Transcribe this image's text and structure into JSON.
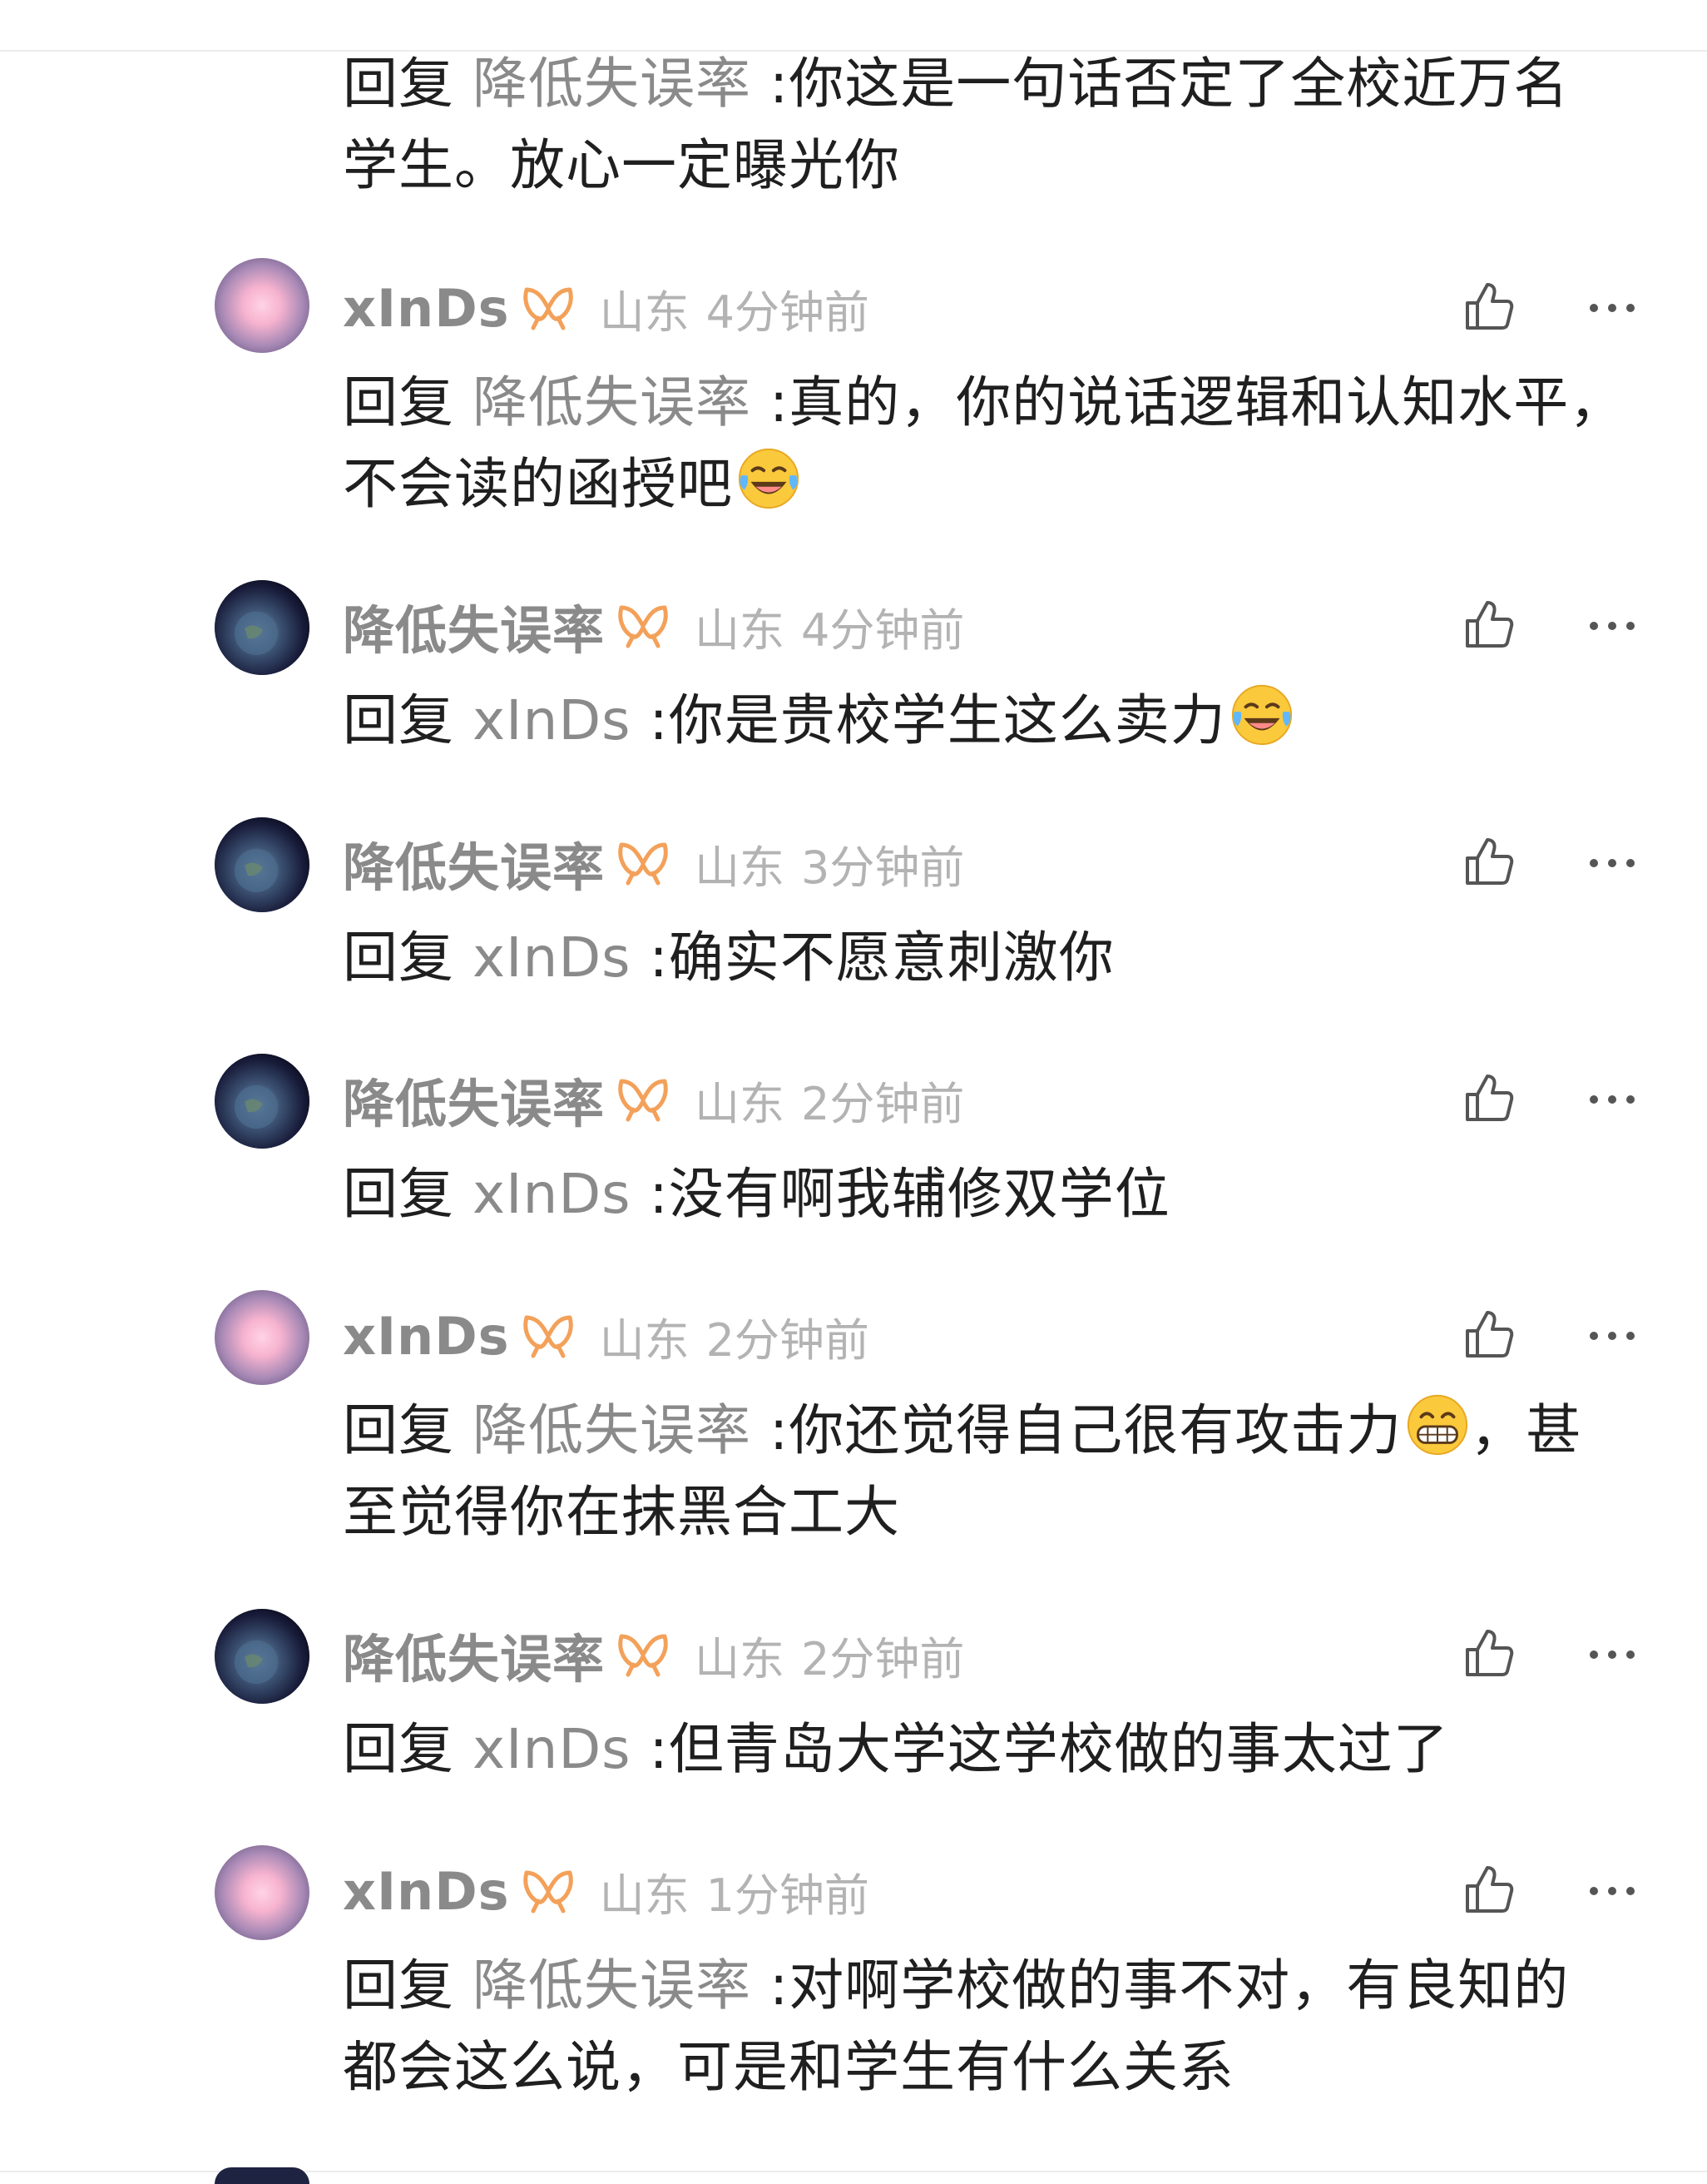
{
  "top_partial": {
    "reply_prefix": "回复",
    "target": "降低失误率",
    "text_line1": " :你这是一句话否定了全校近万名",
    "text_line2": "学生。放心一定曝光你"
  },
  "comments": [
    {
      "avatar": "pink-avatar",
      "name": "xInDs",
      "location": "山东",
      "time": "4分钟前",
      "reply_prefix": "回复",
      "target": "降低失误率",
      "line1": " :真的，你的说话逻辑和认知水平，",
      "line2": "不会读的函授吧",
      "emoji": "laughing-crying"
    },
    {
      "avatar": "planet-avatar",
      "name": "降低失误率",
      "location": "山东",
      "time": "4分钟前",
      "reply_prefix": "回复",
      "target": "xInDs",
      "line1": " :你是贵校学生这么卖力",
      "emoji": "laughing-crying"
    },
    {
      "avatar": "planet-avatar",
      "name": "降低失误率",
      "location": "山东",
      "time": "3分钟前",
      "reply_prefix": "回复",
      "target": "xInDs",
      "line1": " :确实不愿意刺激你"
    },
    {
      "avatar": "planet-avatar",
      "name": "降低失误率",
      "location": "山东",
      "time": "2分钟前",
      "reply_prefix": "回复",
      "target": "xInDs",
      "line1": " :没有啊我辅修双学位"
    },
    {
      "avatar": "pink-avatar",
      "name": "xInDs",
      "location": "山东",
      "time": "2分钟前",
      "reply_prefix": "回复",
      "target": "降低失误率",
      "line1_a": " :你还觉得自己很有攻击力",
      "line1_b": "，甚",
      "line2": "至觉得你在抹黑合工大",
      "emoji": "grinning"
    },
    {
      "avatar": "planet-avatar",
      "name": "降低失误率",
      "location": "山东",
      "time": "2分钟前",
      "reply_prefix": "回复",
      "target": "xInDs",
      "line1": " :但青岛大学这学校做的事太过了"
    },
    {
      "avatar": "pink-avatar",
      "name": "xInDs",
      "location": "山东",
      "time": "1分钟前",
      "reply_prefix": "回复",
      "target": "降低失误率",
      "line1": " :对啊学校做的事不对，有良知的",
      "line2": "都会这么说，可是和学生有什么关系"
    }
  ],
  "icons": {
    "badge": "vip-ribbon-icon",
    "like": "thumbs-up-icon",
    "more": "more-dots-icon"
  },
  "colors": {
    "badge": "#f3a15a",
    "name": "#8a8a8a",
    "meta": "#b3b3b3",
    "text": "#1f1f1f"
  }
}
